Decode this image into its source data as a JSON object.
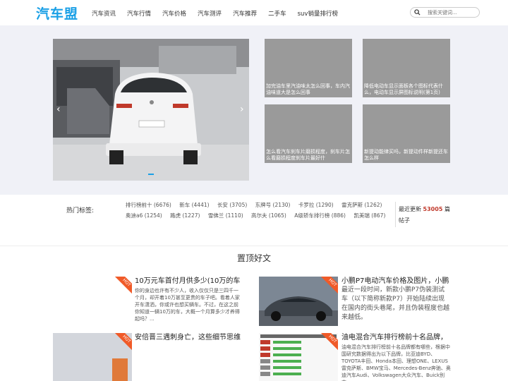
{
  "header": {
    "logo": "汽车盟",
    "nav": [
      "汽车资讯",
      "汽车行情",
      "汽车价格",
      "汽车测评",
      "汽车推荐",
      "二手车",
      "suv销量排行榜"
    ],
    "search_placeholder": "搜索关键词..."
  },
  "hero": {
    "prev": "‹",
    "next": "›",
    "thumbs": [
      "加完油车里汽油味太怎么回事，车内汽油味道大是怎么回事",
      "降低电动车显示面板各个图标代表什么，电动车显示屏图标说明(第1页)",
      "怎么看汽车刹车片磨损程度，刹车片怎么看磨损程度刹车片最好什",
      "新提动能律买吗，新提动件样新提还车怎么样"
    ]
  },
  "tags": {
    "label": "热门标签:",
    "row1": [
      "排行榜前十 (6676)",
      "新车 (4441)",
      "长安 (3705)",
      "东牌号 (2130)",
      "卡罗拉 (1290)",
      "雷克萨斯 (1262)"
    ],
    "row2": [
      "奥迪a6 (1254)",
      "路虎 (1227)",
      "雪佛兰 (1110)",
      "高尔夫 (1065)",
      "A级轿车排行榜 (886)",
      "凯美瑞 (867)"
    ],
    "latest_prefix": "最近更新",
    "latest_count": "53005",
    "latest_suffix": "篇帖子"
  },
  "pinned": {
    "title": "置顶好文",
    "hot_label": "HOT",
    "cards": [
      {
        "title": "10万元车首付月供多少(10万的车",
        "desc": "你的身边也许有不少人，收入仅仅只是三四千一个月，却开着10万甚至更贵的车子吧。看着人家开车潇洒，你或许也想买辆车。不过，在这之前你知道一辆10万的车，大概一个月算多少才养得起吗？..."
      },
      {
        "title": "小鹏P7电动汽车价格及图片，小鹏",
        "desc": "最近一段时间，新款小鹏P7伪装测试车（以下简称新款P7）开始陆续出现在国内的街头巷尾，并且伪装程度也越来越低。"
      },
      {
        "title": "安倍晋三遇刺身亡，这些细节思维",
        "desc": ""
      },
      {
        "title": "油电混合汽车排行榜前十名品牌，",
        "desc": "油电混合汽车排行榜前十名品牌都有哪些，根据中国研究数据得出为以下品牌，比亚迪BYD、TOYOTA丰田、Honda本田、理想ONE、LEXUS雷克萨斯、BMW宝马、Mercedes-Benz奔驰、奥迪汽车Audi、Volkswagen大众汽车、Buick别克..."
      }
    ]
  }
}
